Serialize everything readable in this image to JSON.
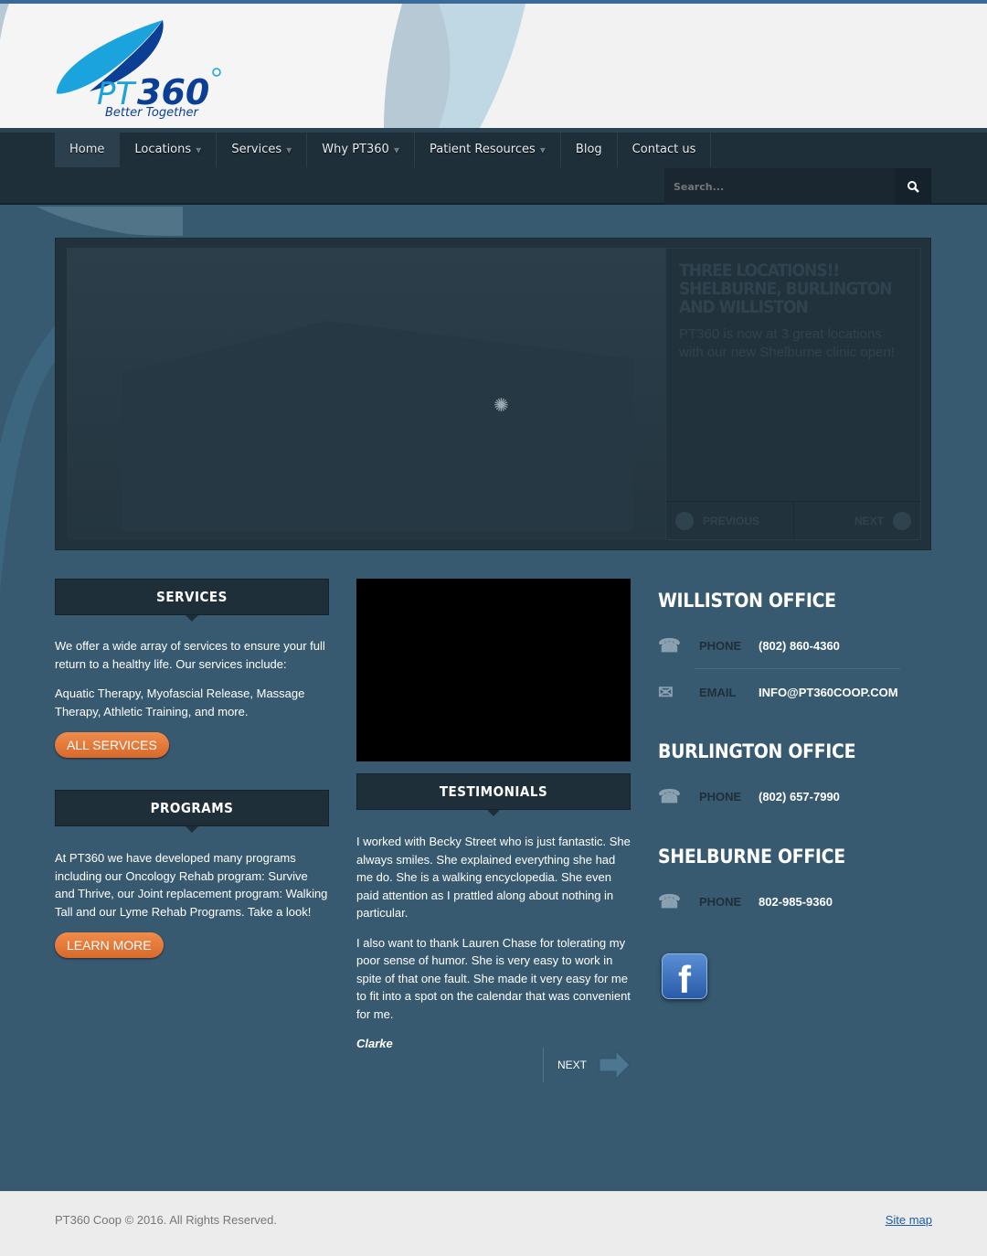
{
  "brand": {
    "name": "PT360",
    "tagline": "Better Together"
  },
  "nav": {
    "items": [
      {
        "label": "Home",
        "dropdown": false,
        "active": true
      },
      {
        "label": "Locations",
        "dropdown": true
      },
      {
        "label": "Services",
        "dropdown": true
      },
      {
        "label": "Why PT360",
        "dropdown": true
      },
      {
        "label": "Patient Resources",
        "dropdown": true
      },
      {
        "label": "Blog",
        "dropdown": false
      },
      {
        "label": "Contact us",
        "dropdown": false
      }
    ]
  },
  "search": {
    "placeholder": "Search..."
  },
  "slider": {
    "title": "THREE LOCATIONS!! SHELBURNE, BURLINGTON AND WILLISTON",
    "text": "PT360 is now at 3 great locations with our new Shelburne clinic open!",
    "prev_label": "PREVIOUS",
    "next_label": "NEXT"
  },
  "services": {
    "heading": "SERVICES",
    "p1": "We offer a wide array of services to ensure your full return to a healthy life. Our services include:",
    "p2": "Aquatic Therapy, Myofascial Release, Massage Therapy, Athletic Training, and more.",
    "button": "ALL SERVICES"
  },
  "programs": {
    "heading": "PROGRAMS",
    "p1": "At PT360 we have developed many programs including our Oncology Rehab program: Survive and Thrive, our Joint replacement program: Walking Tall and our Lyme Rehab Programs. Take a look!",
    "button": "LEARN MORE"
  },
  "testimonials": {
    "heading": "TESTIMONIALS",
    "p1": "I worked with Becky Street who is just fantastic. She always smiles.  She explained everything she had me do.  She is a walking encyclopedia.  She even paid attention as I prattled along about nothing in particular.",
    "p2": "I also want to thank Lauren Chase for tolerating my poor sense of humor.  She is very easy to work in spite of that one fault.  She made it very easy for me to fit into a spot on the calendar that was convenient for me.",
    "author": "Clarke",
    "next": "NEXT"
  },
  "offices": [
    {
      "name": "WILLISTON OFFICE",
      "phone_label": "PHONE",
      "phone": "(802) 860-4360",
      "email_label": "EMAIL",
      "email": "INFO@PT360COOP.COM"
    },
    {
      "name": "BURLINGTON OFFICE",
      "phone_label": "PHONE",
      "phone": "(802) 657-7990"
    },
    {
      "name": "SHELBURNE OFFICE",
      "phone_label": "PHONE",
      "phone": "802-985-9360"
    }
  ],
  "social": {
    "facebook_icon": "f"
  },
  "footer": {
    "copyright": "PT360 Coop © 2016. All Rights Reserved.",
    "sitemap": "Site map"
  }
}
